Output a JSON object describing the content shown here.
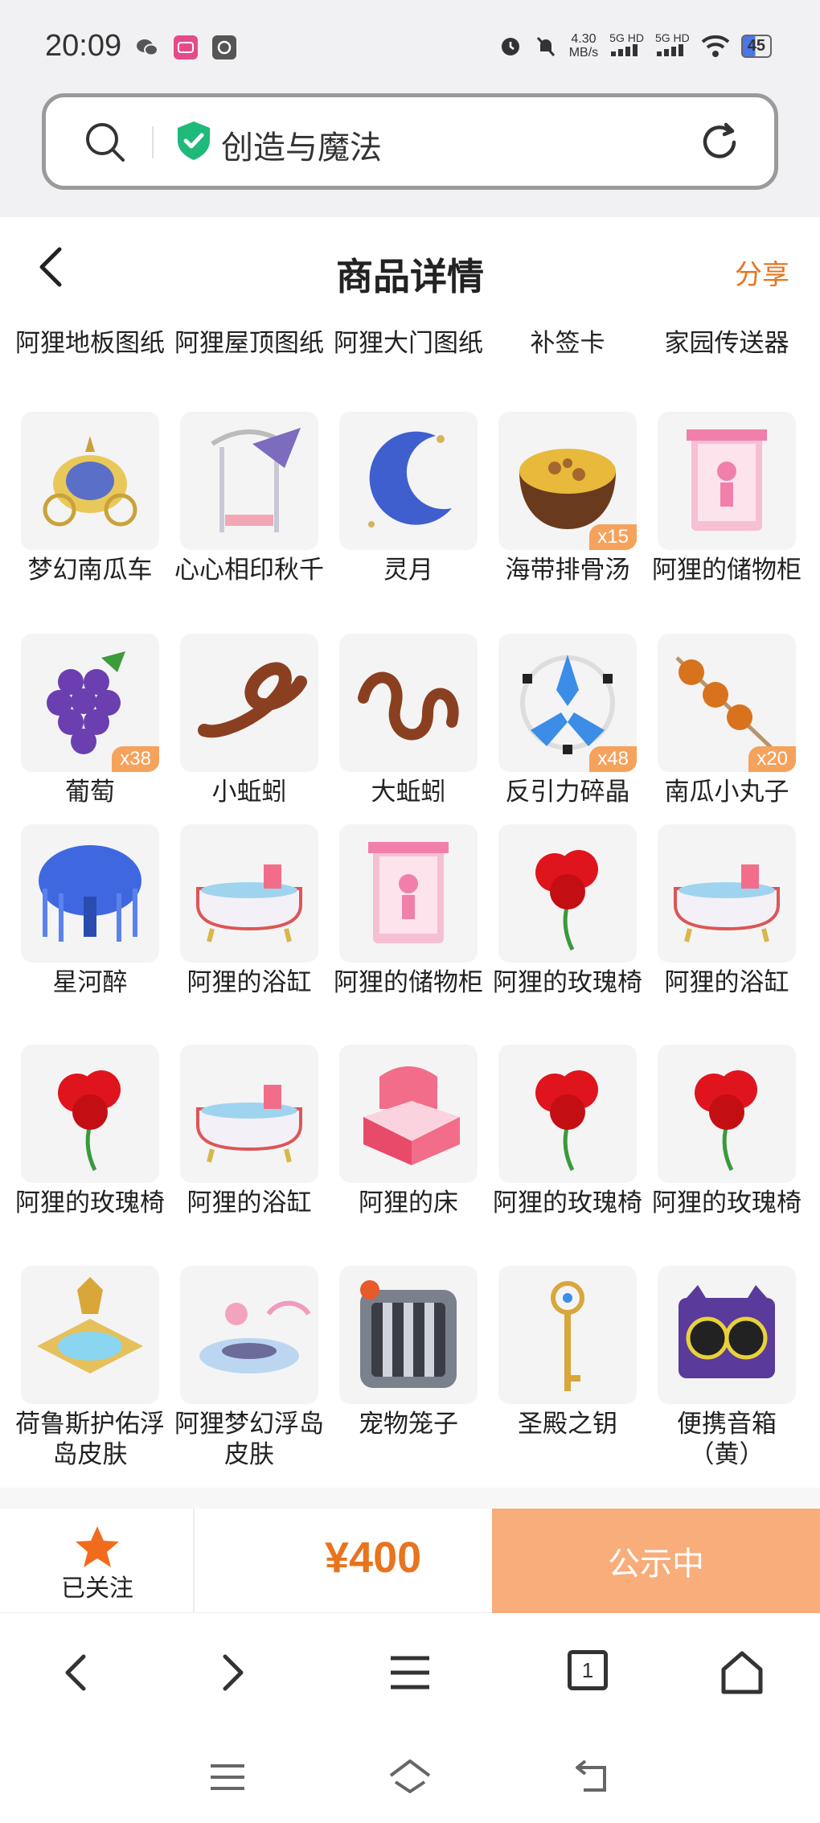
{
  "status": {
    "time": "20:09",
    "net_speed_top": "4.30",
    "net_speed_unit": "MB/s",
    "signal1": "5G HD",
    "signal2": "5G HD",
    "battery": "45"
  },
  "search": {
    "text": "创造与魔法"
  },
  "header": {
    "title": "商品详情",
    "share": "分享"
  },
  "top_row": [
    "阿狸地板图纸",
    "阿狸屋顶图纸",
    "阿狸大门图纸",
    "补签卡",
    "家园传送器"
  ],
  "items": [
    {
      "name": "梦幻南瓜车",
      "icon": "pumpkin-carriage-icon"
    },
    {
      "name": "心心相印秋千",
      "icon": "heart-swing-icon"
    },
    {
      "name": "灵月",
      "icon": "crescent-moon-icon"
    },
    {
      "name": "海带排骨汤",
      "icon": "soup-bowl-icon",
      "qty": "x15"
    },
    {
      "name": "阿狸的储物柜",
      "icon": "pink-cabinet-icon"
    },
    {
      "name": "葡萄",
      "icon": "grapes-icon",
      "qty": "x38"
    },
    {
      "name": "小蚯蚓",
      "icon": "small-worm-icon"
    },
    {
      "name": "大蚯蚓",
      "icon": "big-worm-icon"
    },
    {
      "name": "反引力碎晶",
      "icon": "crystal-icon",
      "qty": "x48"
    },
    {
      "name": "南瓜小丸子",
      "icon": "skewer-icon",
      "qty": "x20"
    },
    {
      "name": "星河醉",
      "icon": "blue-tree-icon"
    },
    {
      "name": "阿狸的浴缸",
      "icon": "bathtub-icon"
    },
    {
      "name": "阿狸的储物柜",
      "icon": "pink-cabinet-icon"
    },
    {
      "name": "阿狸的玫瑰椅",
      "icon": "rose-icon"
    },
    {
      "name": "阿狸的浴缸",
      "icon": "bathtub-icon"
    },
    {
      "name": "阿狸的玫瑰椅",
      "icon": "rose-icon"
    },
    {
      "name": "阿狸的浴缸",
      "icon": "bathtub-icon"
    },
    {
      "name": "阿狸的床",
      "icon": "pink-bed-icon"
    },
    {
      "name": "阿狸的玫瑰椅",
      "icon": "rose-icon"
    },
    {
      "name": "阿狸的玫瑰椅",
      "icon": "rose-icon"
    },
    {
      "name": "荷鲁斯护佑浮岛皮肤",
      "icon": "floating-island-gold-icon"
    },
    {
      "name": "阿狸梦幻浮岛皮肤",
      "icon": "floating-island-cloud-icon"
    },
    {
      "name": "宠物笼子",
      "icon": "pet-cage-icon"
    },
    {
      "name": "圣殿之钥",
      "icon": "golden-key-icon"
    },
    {
      "name": "便携音箱（黄）",
      "icon": "speaker-icon"
    }
  ],
  "footer": {
    "follow": "已关注",
    "price": "¥400",
    "status": "公示中"
  },
  "browser": {
    "tab_count": "1"
  },
  "colors": {
    "accent": "#e8741e",
    "status_button": "#f8ad7a",
    "badge": "#f5a25d"
  }
}
